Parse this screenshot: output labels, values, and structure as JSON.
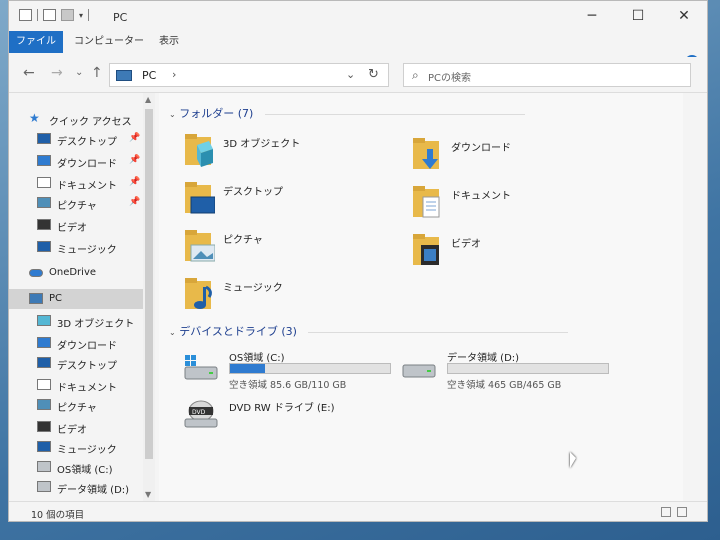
{
  "window": {
    "title": "PC",
    "controls": {
      "minimize": "─",
      "maximize": "☐",
      "close": "✕"
    }
  },
  "ribbon": {
    "tabs": [
      {
        "label": "ファイル"
      },
      {
        "label": "コンピューター"
      },
      {
        "label": "表示"
      }
    ],
    "help": "?"
  },
  "address": {
    "back": "←",
    "forward": "→",
    "recent": "⌄",
    "up": "↑",
    "crumb": "PC",
    "crumb_sep": "›",
    "dropdown": "⌄",
    "refresh": "↻"
  },
  "search": {
    "icon": "⌕",
    "placeholder": "PCの検索"
  },
  "sidebar": {
    "items": [
      {
        "label": "クイック アクセス",
        "icon": "star-icon",
        "pinned": false
      },
      {
        "label": "デスクトップ",
        "icon": "desktop-icon",
        "pinned": true
      },
      {
        "label": "ダウンロード",
        "icon": "download-icon",
        "pinned": true
      },
      {
        "label": "ドキュメント",
        "icon": "document-icon",
        "pinned": true
      },
      {
        "label": "ピクチャ",
        "icon": "picture-icon",
        "pinned": true
      },
      {
        "label": "ビデオ",
        "icon": "video-icon",
        "pinned": false
      },
      {
        "label": "ミュージック",
        "icon": "music-icon",
        "pinned": false
      },
      {
        "label": "OneDrive",
        "icon": "cloud-icon",
        "pinned": false
      },
      {
        "label": "PC",
        "icon": "pc-icon",
        "pinned": false
      },
      {
        "label": "3D オブジェクト",
        "icon": "cube-icon",
        "pinned": false
      },
      {
        "label": "ダウンロード",
        "icon": "download-icon",
        "pinned": false
      },
      {
        "label": "デスクトップ",
        "icon": "desktop-icon",
        "pinned": false
      },
      {
        "label": "ドキュメント",
        "icon": "document-icon",
        "pinned": false
      },
      {
        "label": "ピクチャ",
        "icon": "picture-icon",
        "pinned": false
      },
      {
        "label": "ビデオ",
        "icon": "video-icon",
        "pinned": false
      },
      {
        "label": "ミュージック",
        "icon": "music-icon",
        "pinned": false
      },
      {
        "label": "OS領域 (C:)",
        "icon": "drive-icon",
        "pinned": false
      },
      {
        "label": "データ領域 (D:)",
        "icon": "drive-icon",
        "pinned": false
      }
    ],
    "pin_glyph": "📌"
  },
  "main": {
    "folders_header": "フォルダー (7)",
    "folders": [
      {
        "label": "3D オブジェクト"
      },
      {
        "label": "ダウンロード"
      },
      {
        "label": "デスクトップ"
      },
      {
        "label": "ドキュメント"
      },
      {
        "label": "ピクチャ"
      },
      {
        "label": "ビデオ"
      },
      {
        "label": "ミュージック"
      }
    ],
    "devices_header": "デバイスとドライブ (3)",
    "drives": [
      {
        "name": "OS領域 (C:)",
        "caption": "空き領域 85.6 GB/110 GB",
        "used_fraction": 0.22
      },
      {
        "name": "データ領域 (D:)",
        "caption": "空き領域 465 GB/465 GB",
        "used_fraction": 0.0
      },
      {
        "name": "DVD RW ドライブ (E:)",
        "caption": ""
      }
    ]
  },
  "status": {
    "item_count": "10 個の項目"
  },
  "colors": {
    "accent": "#1f6fc5",
    "drive_fill": "#2f7bd0",
    "header": "#1e3f8f",
    "folder": "#e8b94a"
  }
}
